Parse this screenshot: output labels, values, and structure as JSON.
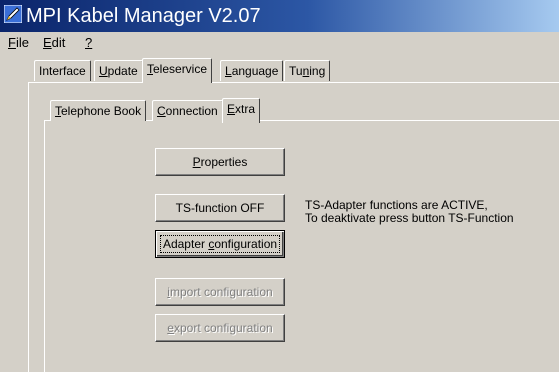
{
  "window": {
    "title": "MPI Kabel Manager V2.07"
  },
  "menubar": {
    "items": [
      "File",
      "Edit",
      "?"
    ]
  },
  "outer_tabs": {
    "items": [
      "Interface",
      "Update",
      "Teleservice",
      "Language",
      "Tuning"
    ],
    "selected": "Teleservice"
  },
  "inner_tabs": {
    "items": [
      "Telephone Book",
      "Connection",
      "Extra"
    ],
    "selected": "Extra"
  },
  "buttons": {
    "properties": "Properties",
    "ts_function": "TS-function OFF",
    "adapter_config": "Adapter configuration",
    "import_config": "import configuration",
    "export_config": "export configuration"
  },
  "status": {
    "line1": "TS-Adapter functions are ACTIVE,",
    "line2": "To deaktivate press button TS-Function"
  },
  "icons": {
    "app": "pencil-app-icon"
  },
  "colors": {
    "titlebar_start": "#0a246a",
    "titlebar_end": "#a6caf0",
    "face": "#d4d0c8"
  }
}
